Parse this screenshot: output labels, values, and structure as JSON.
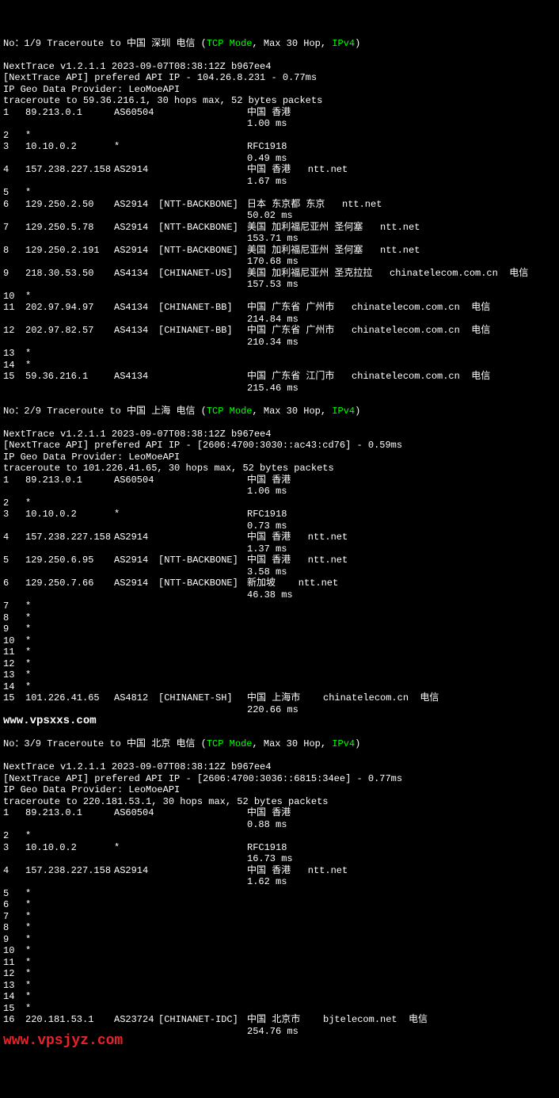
{
  "sections": [
    {
      "header": {
        "prefix": "No：",
        "index": "1/9",
        "label": "Traceroute to",
        "dest": "中国 深圳 电信",
        "mode": "TCP Mode",
        "hops": "Max 30 Hop",
        "ipver": "IPv4"
      },
      "version": "NextTrace v1.2.1.1 2023-09-07T08:38:12Z b967ee4",
      "api": "[NextTrace API] prefered API IP - 104.26.8.231 - 0.77ms",
      "geo": "IP Geo Data Provider: LeoMoeAPI",
      "cmd": "traceroute to 59.36.216.1, 30 hops max, 52 bytes packets",
      "hops": [
        {
          "n": "1",
          "ip": "89.213.0.1",
          "as": "AS60504",
          "nm": "",
          "loc": "中国 香港",
          "lat": "1.00 ms"
        },
        {
          "n": "2",
          "ip": "*"
        },
        {
          "n": "3",
          "ip": "10.10.0.2",
          "as": "*",
          "nm": "",
          "loc": "RFC1918",
          "lat": "0.49 ms"
        },
        {
          "n": "4",
          "ip": "157.238.227.158",
          "as": "AS2914",
          "nm": "",
          "loc": "中国 香港   ntt.net",
          "lat": "1.67 ms"
        },
        {
          "n": "5",
          "ip": "*"
        },
        {
          "n": "6",
          "ip": "129.250.2.50",
          "as": "AS2914",
          "nm": "[NTT-BACKBONE]",
          "loc": "日本 东京都 东京   ntt.net",
          "lat": "50.02 ms"
        },
        {
          "n": "7",
          "ip": "129.250.5.78",
          "as": "AS2914",
          "nm": "[NTT-BACKBONE]",
          "loc": "美国 加利福尼亚州 圣何塞   ntt.net",
          "lat": "153.71 ms"
        },
        {
          "n": "8",
          "ip": "129.250.2.191",
          "as": "AS2914",
          "nm": "[NTT-BACKBONE]",
          "loc": "美国 加利福尼亚州 圣何塞   ntt.net",
          "lat": "170.68 ms"
        },
        {
          "n": "9",
          "ip": "218.30.53.50",
          "as": "AS4134",
          "nm": "[CHINANET-US]",
          "loc": "美国 加利福尼亚州 圣克拉拉   chinatelecom.com.cn  电信",
          "lat": "157.53 ms"
        },
        {
          "n": "10",
          "ip": "*"
        },
        {
          "n": "11",
          "ip": "202.97.94.97",
          "as": "AS4134",
          "nm": "[CHINANET-BB]",
          "loc": "中国 广东省 广州市   chinatelecom.com.cn  电信",
          "lat": "214.84 ms"
        },
        {
          "n": "12",
          "ip": "202.97.82.57",
          "as": "AS4134",
          "nm": "[CHINANET-BB]",
          "loc": "中国 广东省 广州市   chinatelecom.com.cn  电信",
          "lat": "210.34 ms"
        },
        {
          "n": "13",
          "ip": "*"
        },
        {
          "n": "14",
          "ip": "*"
        },
        {
          "n": "15",
          "ip": "59.36.216.1",
          "as": "AS4134",
          "nm": "",
          "loc": "中国 广东省 江门市   chinatelecom.com.cn  电信",
          "lat": "215.46 ms"
        }
      ]
    },
    {
      "header": {
        "prefix": "No：",
        "index": "2/9",
        "label": "Traceroute to",
        "dest": "中国 上海 电信",
        "mode": "TCP Mode",
        "hops": "Max 30 Hop",
        "ipver": "IPv4"
      },
      "version": "NextTrace v1.2.1.1 2023-09-07T08:38:12Z b967ee4",
      "api": "[NextTrace API] prefered API IP - [2606:4700:3030::ac43:cd76] - 0.59ms",
      "geo": "IP Geo Data Provider: LeoMoeAPI",
      "cmd": "traceroute to 101.226.41.65, 30 hops max, 52 bytes packets",
      "hops": [
        {
          "n": "1",
          "ip": "89.213.0.1",
          "as": "AS60504",
          "nm": "",
          "loc": "中国 香港",
          "lat": "1.06 ms"
        },
        {
          "n": "2",
          "ip": "*"
        },
        {
          "n": "3",
          "ip": "10.10.0.2",
          "as": "*",
          "nm": "",
          "loc": "RFC1918",
          "lat": "0.73 ms"
        },
        {
          "n": "4",
          "ip": "157.238.227.158",
          "as": "AS2914",
          "nm": "",
          "loc": "中国 香港   ntt.net",
          "lat": "1.37 ms"
        },
        {
          "n": "5",
          "ip": "129.250.6.95",
          "as": "AS2914",
          "nm": "[NTT-BACKBONE]",
          "loc": "中国 香港   ntt.net",
          "lat": "3.58 ms"
        },
        {
          "n": "6",
          "ip": "129.250.7.66",
          "as": "AS2914",
          "nm": "[NTT-BACKBONE]",
          "loc": "新加坡    ntt.net",
          "lat": "46.38 ms"
        },
        {
          "n": "7",
          "ip": "*"
        },
        {
          "n": "8",
          "ip": "*"
        },
        {
          "n": "9",
          "ip": "*"
        },
        {
          "n": "10",
          "ip": "*"
        },
        {
          "n": "11",
          "ip": "*"
        },
        {
          "n": "12",
          "ip": "*"
        },
        {
          "n": "13",
          "ip": "*"
        },
        {
          "n": "14",
          "ip": "*"
        },
        {
          "n": "15",
          "ip": "101.226.41.65",
          "as": "AS4812",
          "nm": "[CHINANET-SH]",
          "loc": "中国 上海市    chinatelecom.cn  电信",
          "lat": "220.66 ms"
        }
      ],
      "watermark1": "www.vpsxxs.com"
    },
    {
      "header": {
        "prefix": "No：",
        "index": "3/9",
        "label": "Traceroute to",
        "dest": "中国 北京 电信",
        "mode": "TCP Mode",
        "hops": "Max 30 Hop",
        "ipver": "IPv4"
      },
      "version": "NextTrace v1.2.1.1 2023-09-07T08:38:12Z b967ee4",
      "api": "[NextTrace API] prefered API IP - [2606:4700:3036::6815:34ee] - 0.77ms",
      "geo": "IP Geo Data Provider: LeoMoeAPI",
      "cmd": "traceroute to 220.181.53.1, 30 hops max, 52 bytes packets",
      "hops": [
        {
          "n": "1",
          "ip": "89.213.0.1",
          "as": "AS60504",
          "nm": "",
          "loc": "中国 香港",
          "lat": "0.88 ms"
        },
        {
          "n": "2",
          "ip": "*"
        },
        {
          "n": "3",
          "ip": "10.10.0.2",
          "as": "*",
          "nm": "",
          "loc": "RFC1918",
          "lat": "16.73 ms"
        },
        {
          "n": "4",
          "ip": "157.238.227.158",
          "as": "AS2914",
          "nm": "",
          "loc": "中国 香港   ntt.net",
          "lat": "1.62 ms"
        },
        {
          "n": "5",
          "ip": "*"
        },
        {
          "n": "6",
          "ip": "*"
        },
        {
          "n": "7",
          "ip": "*"
        },
        {
          "n": "8",
          "ip": "*"
        },
        {
          "n": "9",
          "ip": "*"
        },
        {
          "n": "10",
          "ip": "*"
        },
        {
          "n": "11",
          "ip": "*"
        },
        {
          "n": "12",
          "ip": "*"
        },
        {
          "n": "13",
          "ip": "*"
        },
        {
          "n": "14",
          "ip": "*"
        },
        {
          "n": "15",
          "ip": "*"
        },
        {
          "n": "16",
          "ip": "220.181.53.1",
          "as": "AS23724",
          "nm": "[CHINANET-IDC]",
          "loc": "中国 北京市    bjtelecom.net  电信",
          "lat": "254.76 ms"
        }
      ],
      "watermark2": "www.vpsjyz.com"
    }
  ]
}
